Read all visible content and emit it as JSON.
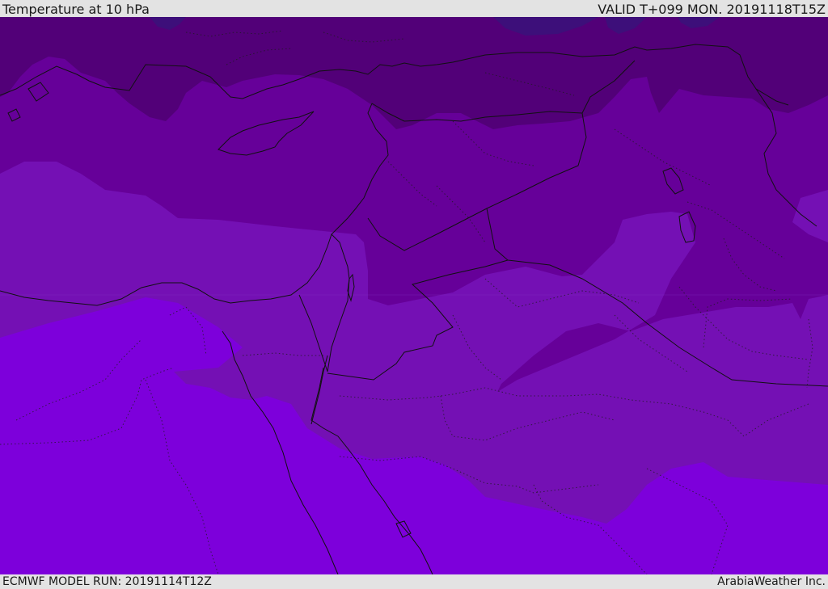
{
  "header": {
    "title": "Temperature at 10 hPa",
    "valid": "VALID T+099 MON. 20191118T15Z"
  },
  "footer": {
    "model_run": "ECMWF MODEL RUN: 20191114T12Z",
    "credit": "ArabiaWeather Inc."
  },
  "map": {
    "colors": {
      "band_1": "#3d0f7a",
      "band_2": "#520078",
      "band_3": "#660099",
      "band_4": "#7410b4",
      "band_5": "#7d00db",
      "coastline": "#111111",
      "borders": "#111111"
    }
  }
}
